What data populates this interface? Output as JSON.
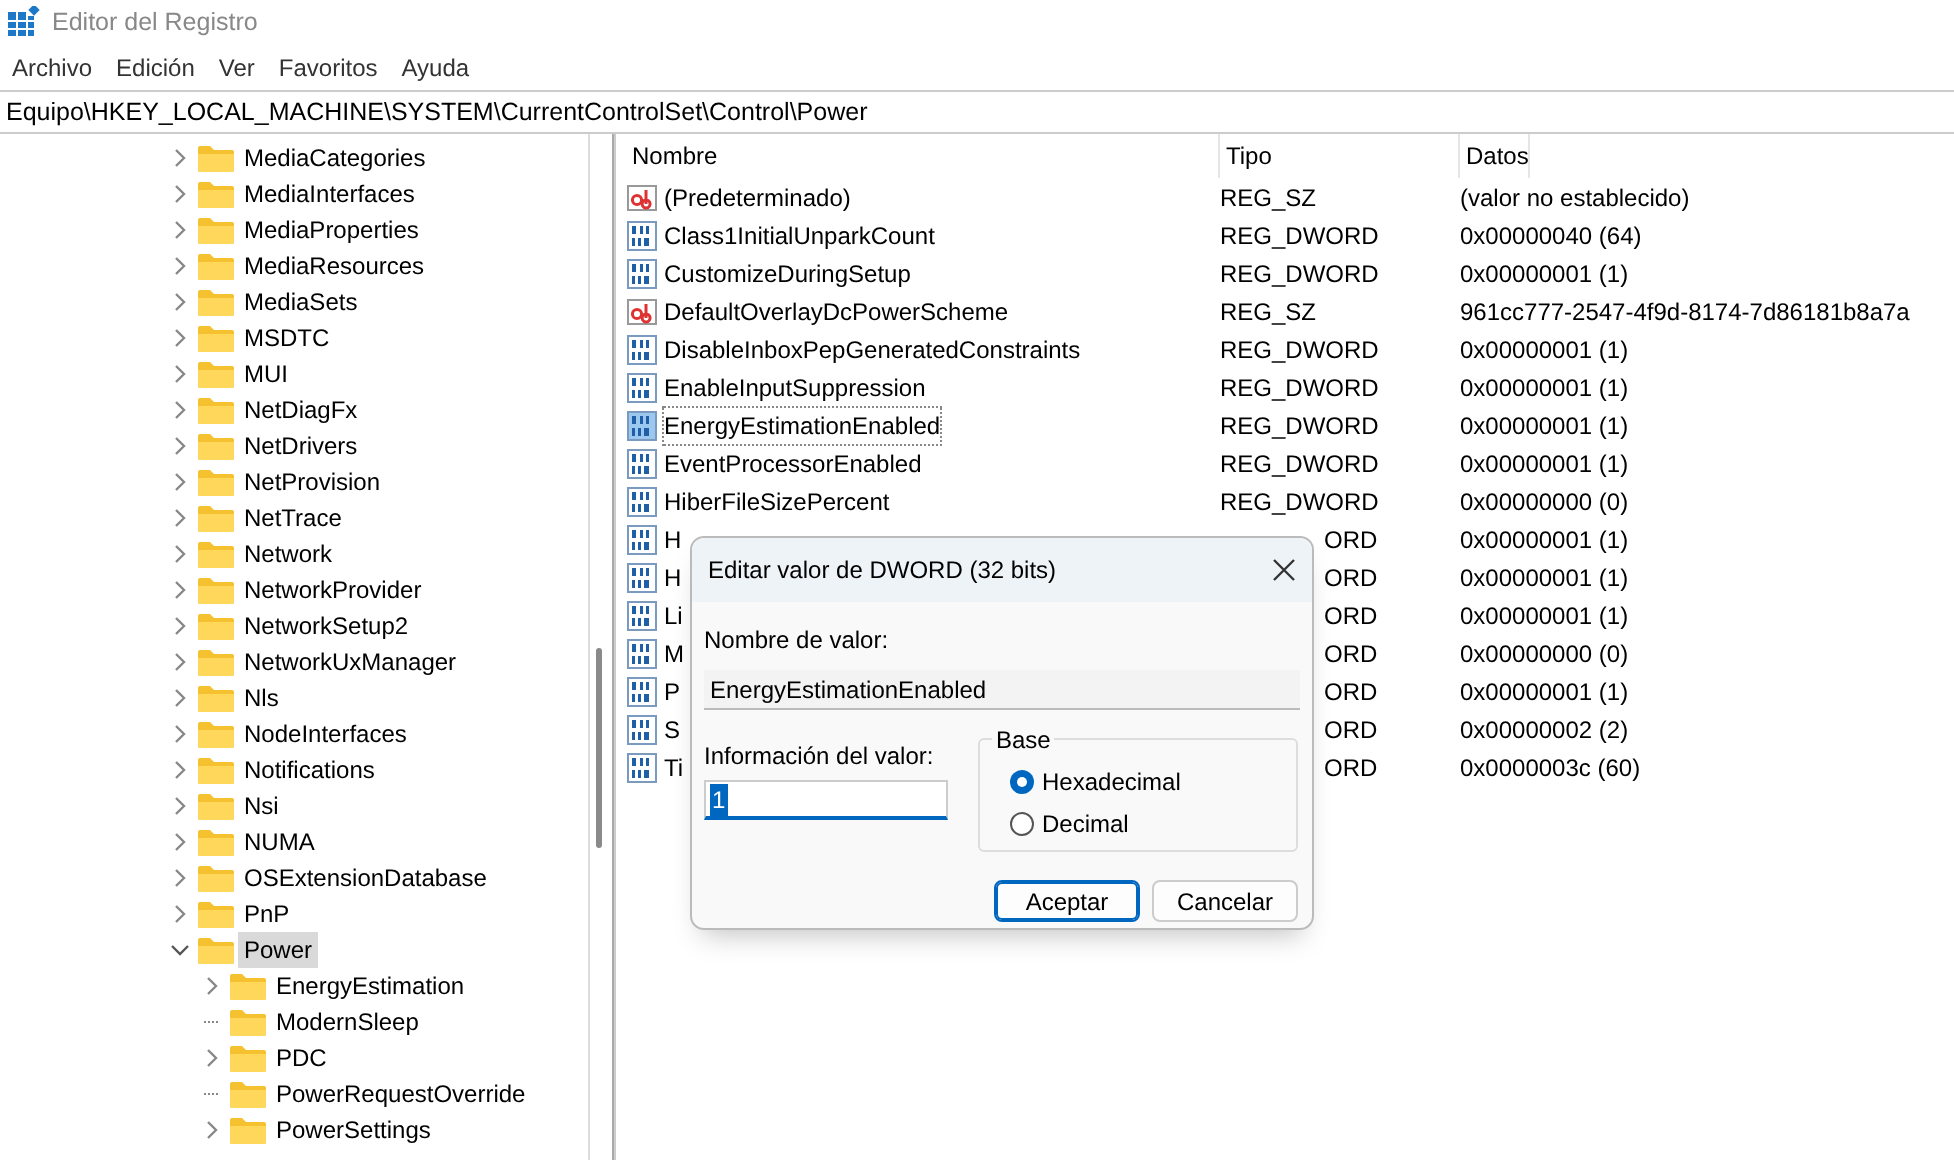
{
  "window": {
    "title": "Editor del Registro"
  },
  "menu": [
    "Archivo",
    "Edición",
    "Ver",
    "Favoritos",
    "Ayuda"
  ],
  "address": "Equipo\\HKEY_LOCAL_MACHINE\\SYSTEM\\CurrentControlSet\\Control\\Power",
  "tree": [
    {
      "label": "MediaCategories",
      "has_children": true,
      "expanded": false,
      "selected": false
    },
    {
      "label": "MediaInterfaces",
      "has_children": true,
      "expanded": false,
      "selected": false
    },
    {
      "label": "MediaProperties",
      "has_children": true,
      "expanded": false,
      "selected": false
    },
    {
      "label": "MediaResources",
      "has_children": true,
      "expanded": false,
      "selected": false
    },
    {
      "label": "MediaSets",
      "has_children": true,
      "expanded": false,
      "selected": false
    },
    {
      "label": "MSDTC",
      "has_children": true,
      "expanded": false,
      "selected": false
    },
    {
      "label": "MUI",
      "has_children": true,
      "expanded": false,
      "selected": false
    },
    {
      "label": "NetDiagFx",
      "has_children": true,
      "expanded": false,
      "selected": false
    },
    {
      "label": "NetDrivers",
      "has_children": true,
      "expanded": false,
      "selected": false
    },
    {
      "label": "NetProvision",
      "has_children": true,
      "expanded": false,
      "selected": false
    },
    {
      "label": "NetTrace",
      "has_children": true,
      "expanded": false,
      "selected": false
    },
    {
      "label": "Network",
      "has_children": true,
      "expanded": false,
      "selected": false
    },
    {
      "label": "NetworkProvider",
      "has_children": true,
      "expanded": false,
      "selected": false
    },
    {
      "label": "NetworkSetup2",
      "has_children": true,
      "expanded": false,
      "selected": false
    },
    {
      "label": "NetworkUxManager",
      "has_children": true,
      "expanded": false,
      "selected": false
    },
    {
      "label": "Nls",
      "has_children": true,
      "expanded": false,
      "selected": false
    },
    {
      "label": "NodeInterfaces",
      "has_children": true,
      "expanded": false,
      "selected": false
    },
    {
      "label": "Notifications",
      "has_children": true,
      "expanded": false,
      "selected": false
    },
    {
      "label": "Nsi",
      "has_children": true,
      "expanded": false,
      "selected": false
    },
    {
      "label": "NUMA",
      "has_children": true,
      "expanded": false,
      "selected": false
    },
    {
      "label": "OSExtensionDatabase",
      "has_children": true,
      "expanded": false,
      "selected": false
    },
    {
      "label": "PnP",
      "has_children": true,
      "expanded": false,
      "selected": false
    },
    {
      "label": "Power",
      "has_children": true,
      "expanded": true,
      "selected": true,
      "children": [
        {
          "label": "EnergyEstimation",
          "has_children": true,
          "expanded": false,
          "selected": false
        },
        {
          "label": "ModernSleep",
          "has_children": false,
          "selected": false
        },
        {
          "label": "PDC",
          "has_children": true,
          "expanded": false,
          "selected": false
        },
        {
          "label": "PowerRequestOverride",
          "has_children": false,
          "selected": false
        },
        {
          "label": "PowerSettings",
          "has_children": true,
          "expanded": false,
          "selected": false
        }
      ]
    }
  ],
  "table": {
    "columns": [
      "Nombre",
      "Tipo",
      "Datos"
    ],
    "rows": [
      {
        "kind": "string",
        "name": "(Predeterminado)",
        "type": "REG_SZ",
        "data": "(valor no establecido)",
        "selected": false
      },
      {
        "kind": "dword",
        "name": "Class1InitialUnparkCount",
        "type": "REG_DWORD",
        "data": "0x00000040 (64)",
        "selected": false,
        "covered": false
      },
      {
        "kind": "dword",
        "name": "CustomizeDuringSetup",
        "type": "REG_DWORD",
        "data": "0x00000001 (1)",
        "selected": false,
        "covered": false
      },
      {
        "kind": "string",
        "name": "DefaultOverlayDcPowerScheme",
        "type": "REG_SZ",
        "data": "961cc777-2547-4f9d-8174-7d86181b8a7a",
        "selected": false
      },
      {
        "kind": "dword",
        "name": "DisableInboxPepGeneratedConstraints",
        "type": "REG_DWORD",
        "data": "0x00000001 (1)",
        "selected": false,
        "covered": false
      },
      {
        "kind": "dword",
        "name": "EnableInputSuppression",
        "type": "REG_DWORD",
        "data": "0x00000001 (1)",
        "selected": false,
        "covered": false
      },
      {
        "kind": "dword",
        "name": "EnergyEstimationEnabled",
        "type": "REG_DWORD",
        "data": "0x00000001 (1)",
        "selected": true,
        "covered": false
      },
      {
        "kind": "dword",
        "name": "EventProcessorEnabled",
        "type": "REG_DWORD",
        "data": "0x00000001 (1)",
        "selected": false,
        "covered": false
      },
      {
        "kind": "dword",
        "name": "HiberFileSizePercent",
        "type": "REG_DWORD",
        "data": "0x00000000 (0)",
        "selected": false,
        "covered": false
      },
      {
        "kind": "dword",
        "name": "H",
        "type": "ORD",
        "data": "0x00000001 (1)",
        "selected": false,
        "covered": true
      },
      {
        "kind": "dword",
        "name": "H",
        "type": "ORD",
        "data": "0x00000001 (1)",
        "selected": false,
        "covered": true
      },
      {
        "kind": "dword",
        "name": "Li",
        "type": "ORD",
        "data": "0x00000001 (1)",
        "selected": false,
        "covered": true
      },
      {
        "kind": "dword",
        "name": "M",
        "type": "ORD",
        "data": "0x00000000 (0)",
        "selected": false,
        "covered": true
      },
      {
        "kind": "dword",
        "name": "P",
        "type": "ORD",
        "data": "0x00000001 (1)",
        "selected": false,
        "covered": true
      },
      {
        "kind": "dword",
        "name": "S",
        "type": "ORD",
        "data": "0x00000002 (2)",
        "selected": false,
        "covered": true
      },
      {
        "kind": "dword",
        "name": "Ti",
        "type": "ORD",
        "data": "0x0000003c (60)",
        "selected": false,
        "covered": true
      }
    ]
  },
  "dialog": {
    "title": "Editar valor de DWORD (32 bits)",
    "name_label": "Nombre de valor:",
    "name_value": "EnergyEstimationEnabled",
    "data_label": "Información del valor:",
    "data_value": "1",
    "base_label": "Base",
    "base_options": [
      {
        "label": "Hexadecimal",
        "selected": true
      },
      {
        "label": "Decimal",
        "selected": false
      }
    ],
    "buttons": [
      {
        "label": "Aceptar",
        "default": true
      },
      {
        "label": "Cancelar",
        "default": false
      }
    ]
  }
}
